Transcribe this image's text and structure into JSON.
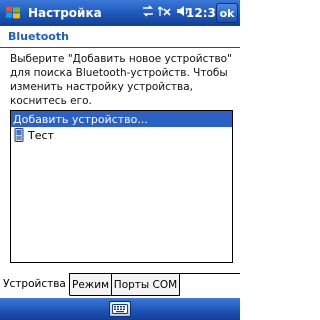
{
  "titlebar": {
    "title": "Настройка",
    "time": "12:39",
    "ok_label": "ok"
  },
  "page": {
    "header": "Bluetooth"
  },
  "description": "Выберите \"Добавить новое устройство\" для поиска Bluetooth-устройств. Чтобы изменить настройку устройства, коснитесь его.",
  "devices": [
    {
      "label": "Добавить устройство...",
      "selected": true
    },
    {
      "label": "Тест",
      "selected": false
    }
  ],
  "tabs": [
    {
      "label": "Устройства",
      "active": true
    },
    {
      "label": "Режим",
      "active": false
    },
    {
      "label": "Порты COM",
      "active": false
    }
  ],
  "icons": [
    "windows-start-icon",
    "connectivity-icon",
    "signal-off-icon",
    "volume-icon",
    "phone-device-icon",
    "keyboard-icon"
  ],
  "colors": {
    "titlebar": "#1e56b8",
    "accent": "#1f5fbf",
    "selection": "#2b61c4"
  }
}
